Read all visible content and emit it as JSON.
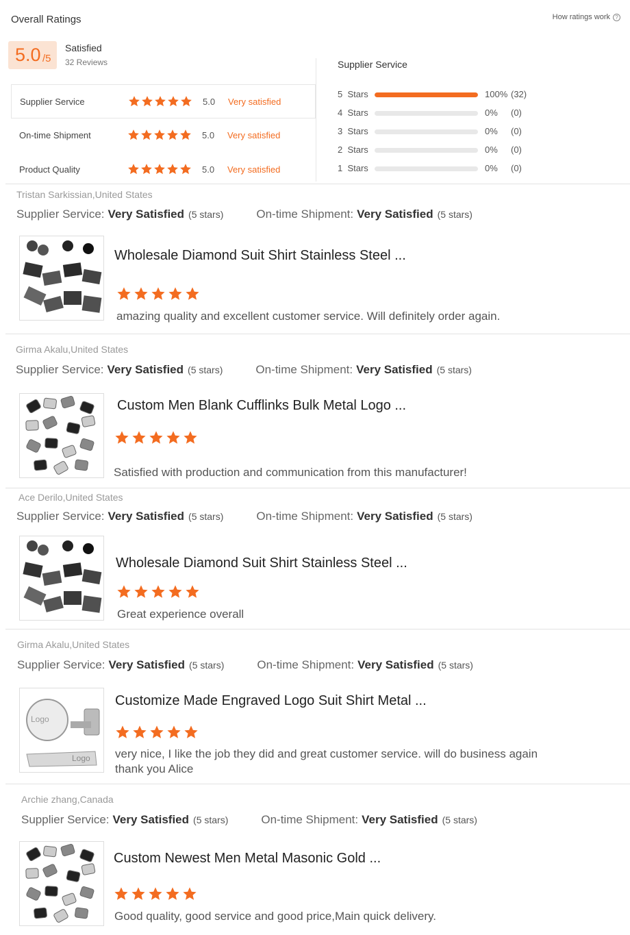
{
  "header": {
    "title": "Overall Ratings",
    "how_ratings_work": "How ratings work",
    "help_icon": "?"
  },
  "summary": {
    "score": "5.0",
    "score_suffix": "/5",
    "label": "Satisfied",
    "reviews": "32 Reviews"
  },
  "category_ratings": [
    {
      "label": "Supplier Service",
      "score": "5.0",
      "text": "Very satisfied",
      "stars": 5
    },
    {
      "label": "On-time Shipment",
      "score": "5.0",
      "text": "Very satisfied",
      "stars": 5
    },
    {
      "label": "Product Quality",
      "score": "5.0",
      "text": "Very satisfied",
      "stars": 5
    }
  ],
  "distribution": {
    "title": "Supplier Service",
    "rows": [
      {
        "label": "5  Stars",
        "fraction": 1.0,
        "pct": "100%",
        "count": "(32)"
      },
      {
        "label": "4  Stars",
        "fraction": 0.0,
        "pct": "0%",
        "count": "(0)"
      },
      {
        "label": "3  Stars",
        "fraction": 0.0,
        "pct": "0%",
        "count": "(0)"
      },
      {
        "label": "2  Stars",
        "fraction": 0.0,
        "pct": "0%",
        "count": "(0)"
      },
      {
        "label": "1  Stars",
        "fraction": 0.0,
        "pct": "0%",
        "count": "(0)"
      }
    ]
  },
  "labels": {
    "supplier_service": "Supplier Service:",
    "ontime_shipment": "On-time Shipment:",
    "very_satisfied": "Very Satisfied",
    "five_stars": "(5 stars)"
  },
  "reviews": [
    {
      "author": "Tristan Sarkissian,United States",
      "product": "Wholesale Diamond Suit Shirt Stainless Steel ...",
      "stars": 5,
      "text": "amazing quality and excellent customer service. Will definitely order again.",
      "thumb": "dark-cufflinks"
    },
    {
      "author": "Girma Akalu,United States",
      "product": "Custom Men Blank Cufflinks Bulk Metal Logo  ...",
      "stars": 5,
      "text": "Satisfied with production and communication from this manufacturer!",
      "thumb": "silver-cufflinks"
    },
    {
      "author": "Ace Derilo,United States",
      "product": "Wholesale Diamond Suit Shirt Stainless Steel ...",
      "stars": 5,
      "text": "Great experience overall",
      "thumb": "dark-cufflinks"
    },
    {
      "author": "Girma Akalu,United States",
      "product": "Customize Made Engraved Logo Suit Shirt Metal  ...",
      "stars": 5,
      "text": "very nice, I like the job they did and great customer service. will do business again thank you Alice",
      "thumb": "logo-cufflink",
      "thumb_text_1": "Logo",
      "thumb_text_2": "Logo"
    },
    {
      "author": "Archie zhang,Canada",
      "product": "Custom Newest Men Metal Masonic Gold  ...",
      "stars": 5,
      "text": "Good quality, good service and good price,Main quick delivery.",
      "thumb": "silver-cufflinks"
    }
  ],
  "colors": {
    "accent": "#f36c20",
    "score_bg": "#fbe3d3",
    "bar_bg": "#e8e8e8"
  }
}
